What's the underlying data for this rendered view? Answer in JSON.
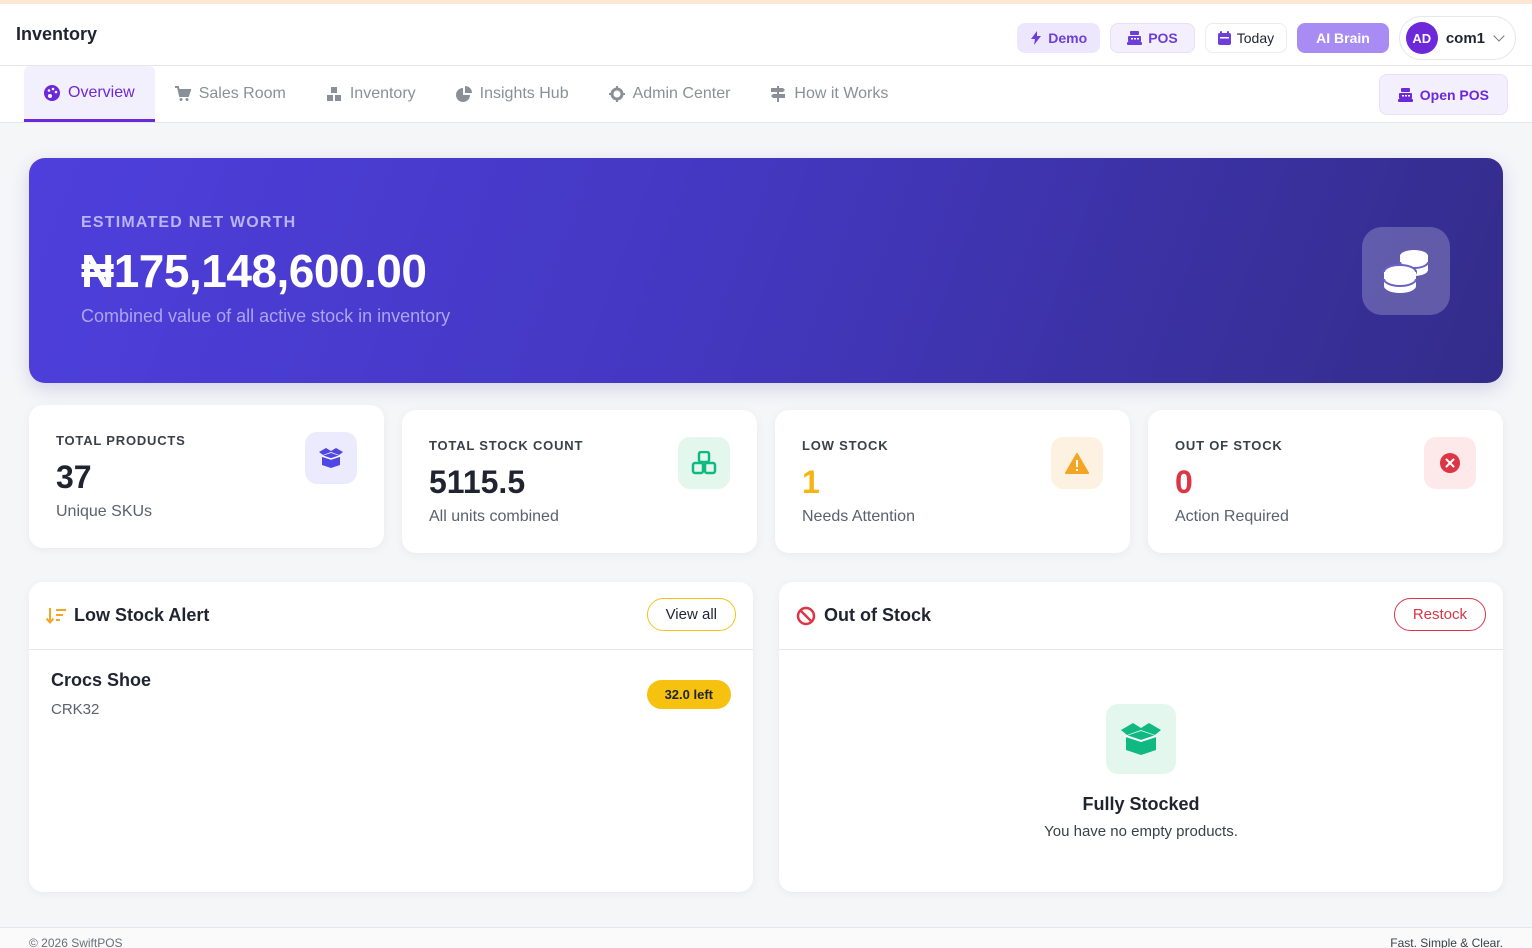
{
  "header": {
    "title": "Inventory",
    "buttons": {
      "demo": "Demo",
      "pos": "POS",
      "today": "Today",
      "ai_brain": "AI Brain"
    },
    "user": {
      "initials": "AD",
      "name": "com1"
    }
  },
  "nav": {
    "tabs": [
      {
        "label": "Overview",
        "icon": "palette-icon"
      },
      {
        "label": "Sales Room",
        "icon": "cart-icon"
      },
      {
        "label": "Inventory",
        "icon": "boxes-icon"
      },
      {
        "label": "Insights Hub",
        "icon": "pie-chart-icon"
      },
      {
        "label": "Admin Center",
        "icon": "gear-icon"
      },
      {
        "label": "How it Works",
        "icon": "signpost-icon"
      }
    ],
    "active_index": 0,
    "open_pos_label": "Open POS"
  },
  "hero": {
    "label": "ESTIMATED NET WORTH",
    "value": "₦175,148,600.00",
    "subtitle": "Combined value of all active stock in inventory",
    "icon": "coins-icon"
  },
  "stats": [
    {
      "label": "TOTAL PRODUCTS",
      "value": "37",
      "sub": "Unique SKUs",
      "icon": "box-open-icon",
      "color": "#4f46e5",
      "bg": "#eceafd"
    },
    {
      "label": "TOTAL STOCK COUNT",
      "value": "5115.5",
      "sub": "All units combined",
      "icon": "cubes-icon",
      "color": "#10b981",
      "bg": "#e4f7ef"
    },
    {
      "label": "LOW STOCK",
      "value": "1",
      "sub": "Needs Attention",
      "icon": "warning-icon",
      "color": "#f5a524",
      "bg": "#fdf2e1"
    },
    {
      "label": "OUT OF STOCK",
      "value": "0",
      "sub": "Action Required",
      "icon": "x-circle-icon",
      "color": "#dc3545",
      "bg": "#fde8ea"
    }
  ],
  "low_stock": {
    "title": "Low Stock Alert",
    "button": "View all",
    "items": [
      {
        "name": "Crocs Shoe",
        "sku": "CRK32",
        "badge": "32.0 left"
      }
    ]
  },
  "out_of_stock": {
    "title": "Out of Stock",
    "button": "Restock",
    "empty_title": "Fully Stocked",
    "empty_sub": "You have no empty products."
  },
  "footer": {
    "left": "© 2026 SwiftPOS",
    "right": "Fast. Simple & Clear."
  },
  "colors": {
    "accent": "#6d28d9",
    "hero_start": "#4e3fdc",
    "hero_end": "#342c8a",
    "warning": "#f6c10f",
    "danger": "#dc3545",
    "success": "#10b981"
  }
}
